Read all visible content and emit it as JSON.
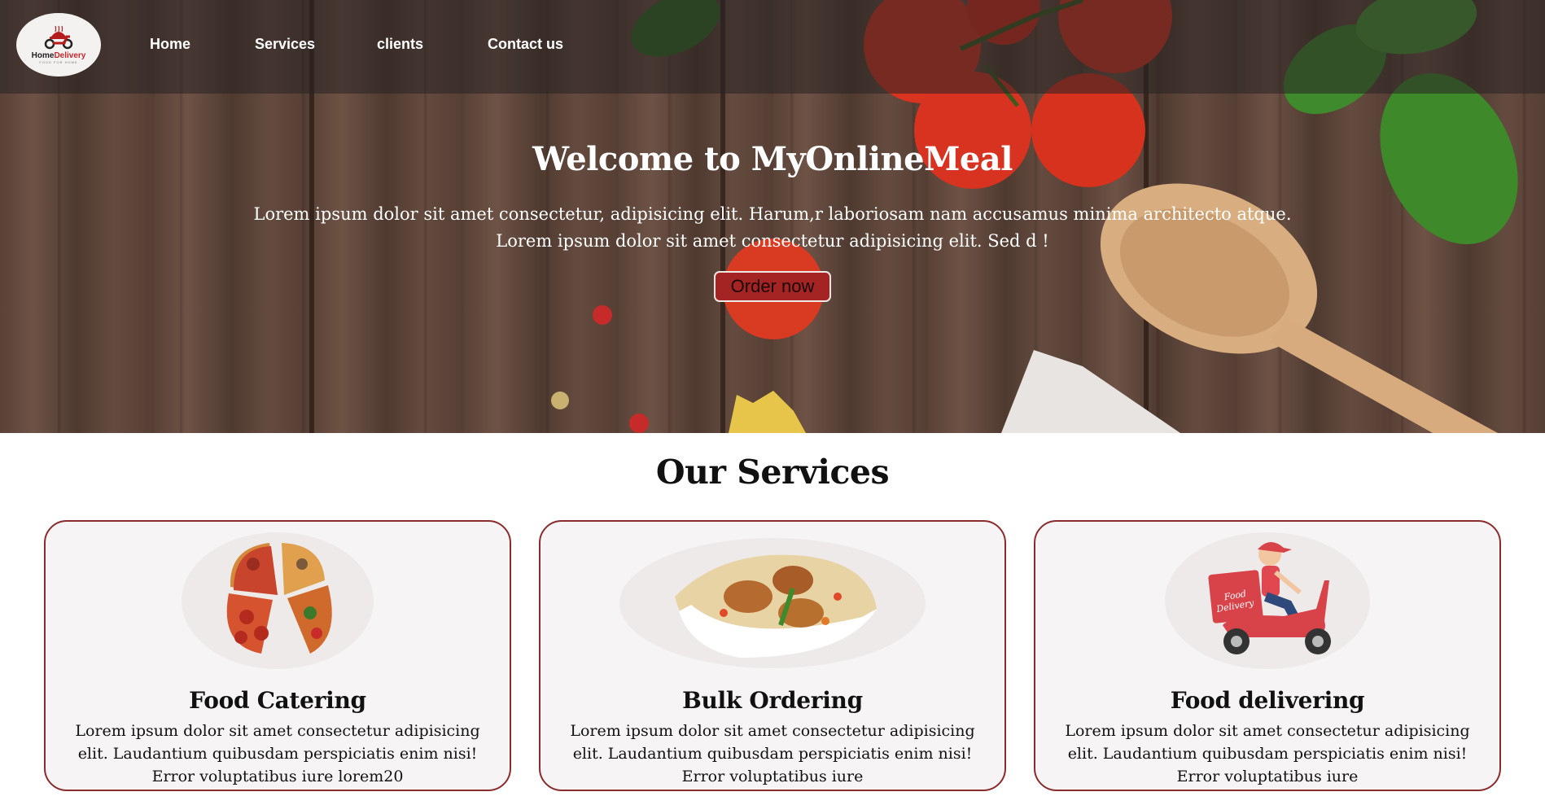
{
  "brand": {
    "logo_text_a": "Home",
    "logo_text_b": "Delivery",
    "logo_sub": "FOOD FOR HOME"
  },
  "nav": {
    "items": [
      "Home",
      "Services",
      "clients",
      "Contact us"
    ]
  },
  "hero": {
    "title": "Welcome to MyOnlineMeal",
    "line1": "Lorem ipsum dolor sit amet consectetur, adipisicing elit. Harum,r laboriosam nam accusamus minima architecto atque.",
    "line2": "Lorem ipsum dolor sit amet consectetur adipisicing elit. Sed d !",
    "button": "Order now"
  },
  "services": {
    "title": "Our Services",
    "cards": [
      {
        "title": "Food Catering",
        "text": "Lorem ipsum dolor sit amet consectetur adipisicing elit. Laudantium quibusdam perspiciatis enim nisi! Error voluptatibus iure lorem20",
        "icon": "pizza-icon"
      },
      {
        "title": "Bulk Ordering",
        "text": "Lorem ipsum dolor sit amet consectetur adipisicing elit. Laudantium quibusdam perspiciatis enim nisi! Error voluptatibus iure",
        "icon": "biryani-icon"
      },
      {
        "title": "Food delivering",
        "text": "Lorem ipsum dolor sit amet consectetur adipisicing elit. Laudantium quibusdam perspiciatis enim nisi! Error voluptatibus iure",
        "icon": "delivery-scooter-icon",
        "badge_line1": "Food",
        "badge_line2": "Delivery"
      }
    ]
  },
  "colors": {
    "accent": "#a42323",
    "card_border": "#8b2b2b",
    "card_bg": "#f6f4f5"
  }
}
